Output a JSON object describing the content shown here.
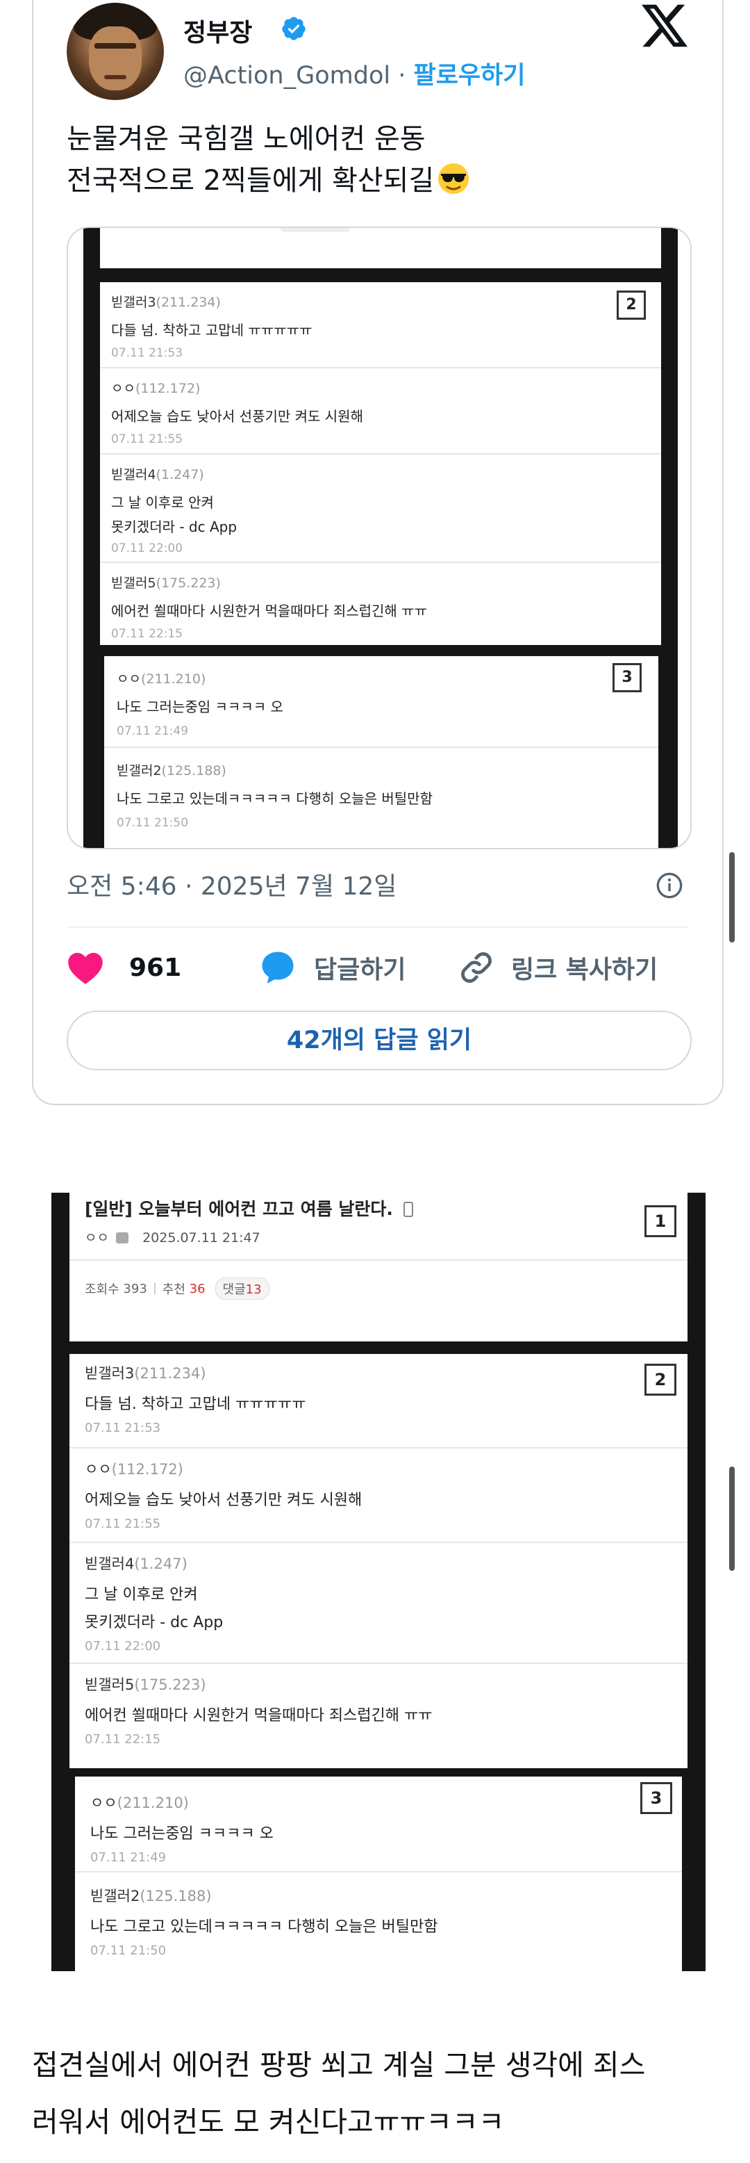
{
  "tweet": {
    "display_name": "정부장",
    "handle": "@Action_Gomdol",
    "separator": " · ",
    "follow_label": "팔로우하기",
    "text_lines": [
      "눈물겨운 국힘갤 노에어컨 운동",
      "전국적으로 2찍들에게 확산되길"
    ],
    "timestamp": "오전 5:46 · 2025년 7월 12일",
    "likes": "961",
    "reply_label": "답글하기",
    "copy_link_label": "링크 복사하기",
    "read_replies_label": "42개의 답글 읽기",
    "icons": [
      "verified-icon",
      "x-logo-icon",
      "sunglasses-emoji",
      "info-icon",
      "heart-icon",
      "comment-bubble-icon",
      "link-icon"
    ]
  },
  "embedded": {
    "box2": {
      "number": "2",
      "comments": [
        {
          "name": "빋갤러3",
          "ip": "(211.234)",
          "lines": [
            "다들 넘. 착하고 고맙네 ㅠㅠㅠㅠㅠ"
          ],
          "date": "07.11 21:53"
        },
        {
          "name": "ㅇㅇ",
          "ip": "(112.172)",
          "lines": [
            "어제오늘 습도 낮아서 선풍기만 켜도 시원해"
          ],
          "date": "07.11 21:55"
        },
        {
          "name": "빋갤러4",
          "ip": "(1.247)",
          "lines": [
            "그 날 이후로 안켜",
            "못키겠더라 - dc App"
          ],
          "date": "07.11 22:00"
        },
        {
          "name": "빋갤러5",
          "ip": "(175.223)",
          "lines": [
            "에어컨 쐴때마다 시원한거 먹을때마다 죄스럽긴해 ㅠㅠ"
          ],
          "date": "07.11 22:15"
        }
      ]
    },
    "box3": {
      "number": "3",
      "comments": [
        {
          "name": "ㅇㅇ",
          "ip": "(211.210)",
          "lines": [
            "나도 그러는중임 ㅋㅋㅋㅋ 오"
          ],
          "date": "07.11 21:49"
        },
        {
          "name": "빋갤러2",
          "ip": "(125.188)",
          "lines": [
            "나도 그로고 있는데ㅋㅋㅋㅋㅋ 다행히 오늘은 버틸만함"
          ],
          "date": "07.11 21:50"
        }
      ]
    }
  },
  "screenshot2": {
    "post": {
      "number": "1",
      "title": "[일반] 오늘부터 에어컨 끄고 여름 날란다.",
      "author": "ㅇㅇ",
      "datetime": "2025.07.11 21:47",
      "views_label": "조회수",
      "views": "393",
      "recommend_label": "추천",
      "recommend": "36",
      "comments_label": "댓글",
      "comments": "13"
    },
    "box2": {
      "number": "2",
      "comments": [
        {
          "name": "빋갤러3",
          "ip": "(211.234)",
          "lines": [
            "다들 넘. 착하고 고맙네 ㅠㅠㅠㅠㅠ"
          ],
          "date": "07.11 21:53"
        },
        {
          "name": "ㅇㅇ",
          "ip": "(112.172)",
          "lines": [
            "어제오늘 습도 낮아서 선풍기만 켜도 시원해"
          ],
          "date": "07.11 21:55"
        },
        {
          "name": "빋갤러4",
          "ip": "(1.247)",
          "lines": [
            "그 날 이후로 안켜",
            "못키겠더라 - dc App"
          ],
          "date": "07.11 22:00"
        },
        {
          "name": "빋갤러5",
          "ip": "(175.223)",
          "lines": [
            "에어컨 쐴때마다 시원한거 먹을때마다 죄스럽긴해 ㅠㅠ"
          ],
          "date": "07.11 22:15"
        }
      ]
    },
    "box3": {
      "number": "3",
      "comments": [
        {
          "name": "ㅇㅇ",
          "ip": "(211.210)",
          "lines": [
            "나도 그러는중임 ㅋㅋㅋㅋ 오"
          ],
          "date": "07.11 21:49"
        },
        {
          "name": "빋갤러2",
          "ip": "(125.188)",
          "lines": [
            "나도 그로고 있는데ㅋㅋㅋㅋㅋ 다행히 오늘은 버틸만함"
          ],
          "date": "07.11 21:50"
        }
      ]
    }
  },
  "caption_lines": [
    "접견실에서 에어컨 팡팡 쐬고 계실 그분 생각에 죄스",
    "러워서 에어컨도 모 켜신다고ㅠㅠㅋㅋㅋ"
  ],
  "colors": {
    "accent": "#1d9bf0",
    "heart": "#f91880",
    "recommend": "#d32f2f"
  }
}
